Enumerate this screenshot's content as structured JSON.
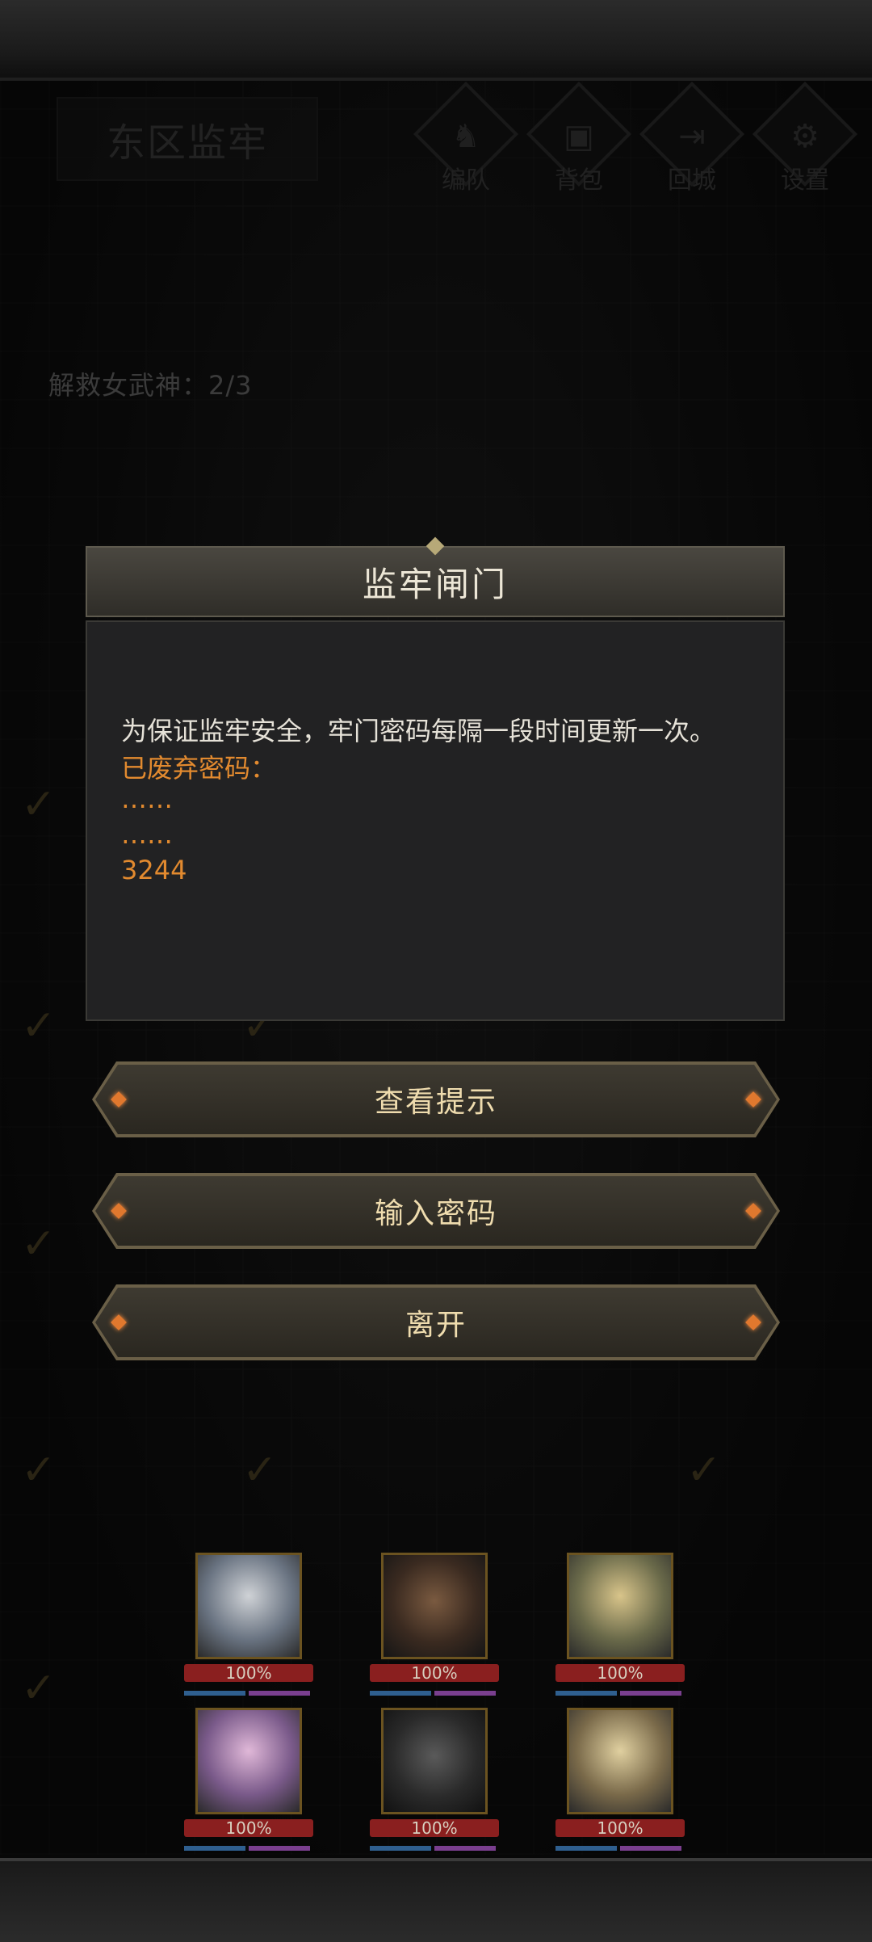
{
  "header": {
    "zone_title": "东区监牢"
  },
  "nav": [
    {
      "label": "编队",
      "icon": "helmet-icon",
      "glyph": "♞"
    },
    {
      "label": "背包",
      "icon": "bag-icon",
      "glyph": "▣"
    },
    {
      "label": "回城",
      "icon": "door-icon",
      "glyph": "⇥"
    },
    {
      "label": "设置",
      "icon": "gear-icon",
      "glyph": "⚙"
    }
  ],
  "progress": {
    "rescue_text": "解救女武神：2/3"
  },
  "dialog": {
    "title": "监牢闸门",
    "lines": {
      "info": "为保证监牢安全，牢门密码每隔一段时间更新一次。",
      "header": "已废弃密码：",
      "line1": "……",
      "line2": "……",
      "code": "3244"
    }
  },
  "buttons": {
    "hint": "查看提示",
    "enter_password": "输入密码",
    "leave": "离开"
  },
  "party": [
    {
      "hp": "100%"
    },
    {
      "hp": "100%"
    },
    {
      "hp": "100%"
    },
    {
      "hp": "100%"
    },
    {
      "hp": "100%"
    },
    {
      "hp": "100%"
    }
  ],
  "colors": {
    "accent_orange": "#e28a2f",
    "button_text": "#efdcae",
    "gem": "#e0782e"
  }
}
